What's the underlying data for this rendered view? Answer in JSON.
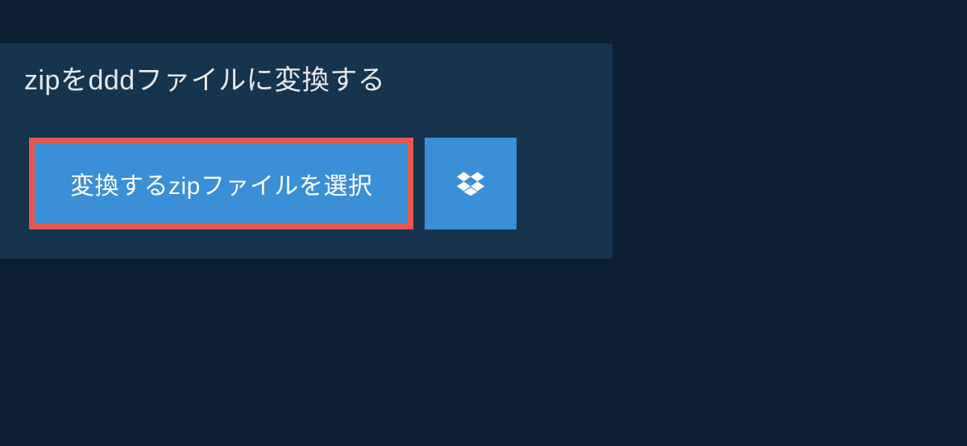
{
  "header": {
    "title": "zipをdddファイルに変換する"
  },
  "actions": {
    "select_file_label": "変換するzipファイルを選択"
  },
  "colors": {
    "background": "#0d1f33",
    "panel": "#17344f",
    "button": "#3b8fd6",
    "highlight_border": "#e35a4a",
    "text": "#ffffff"
  }
}
